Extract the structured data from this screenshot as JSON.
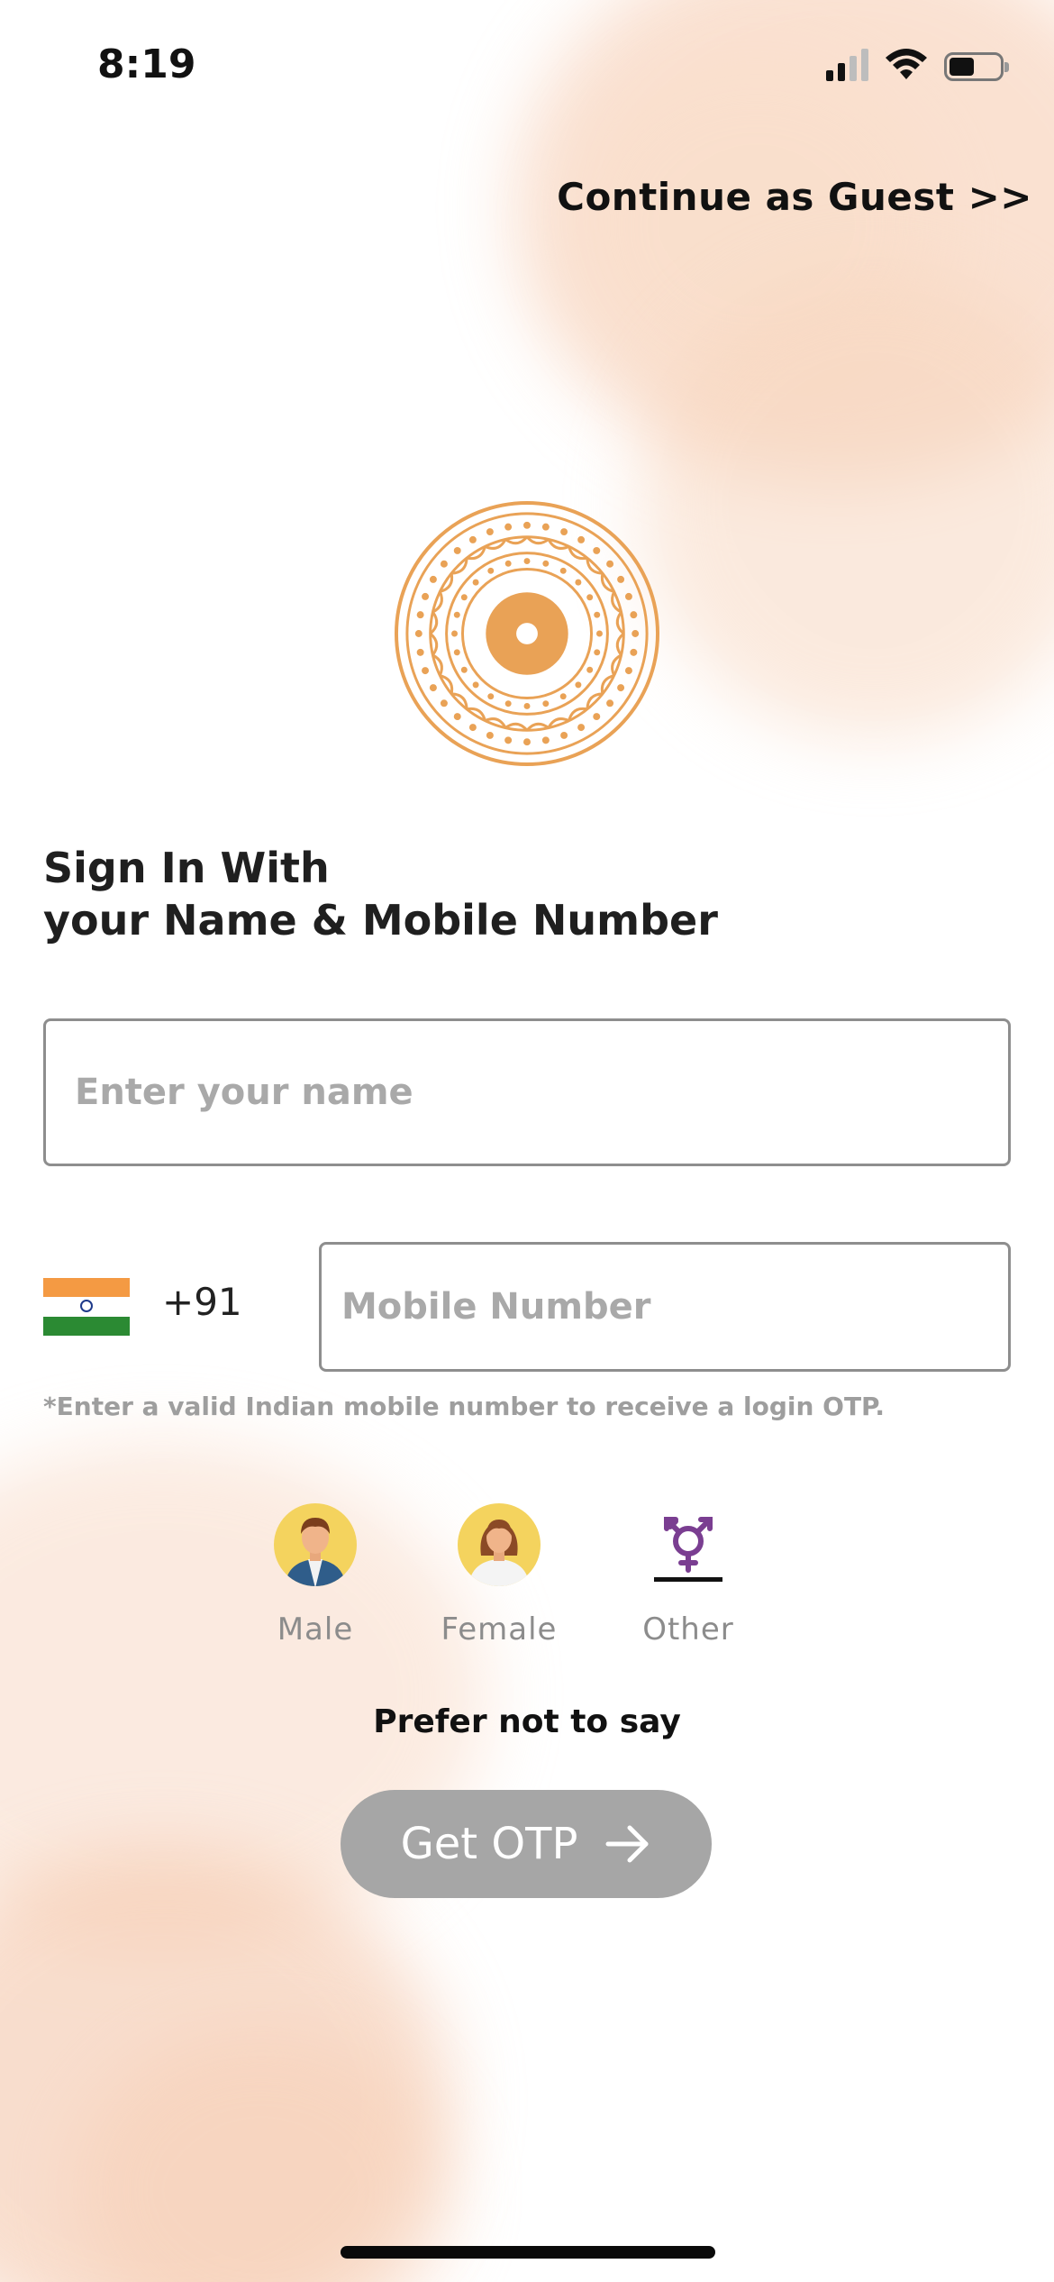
{
  "status_bar": {
    "time": "8:19",
    "icons": [
      "cellular-signal-icon",
      "wifi-icon",
      "battery-icon"
    ]
  },
  "guest_link": "Continue as Guest >>",
  "logo": {
    "icon": "mandala-logo",
    "color": "#e9a256"
  },
  "heading": {
    "line1": "Sign In With",
    "line2": "your Name & Mobile Number"
  },
  "name_field": {
    "placeholder": "Enter your name",
    "value": ""
  },
  "phone": {
    "flag_icon": "india-flag-icon",
    "country_code": "+91",
    "placeholder": "Mobile Number",
    "value": ""
  },
  "hint": "*Enter a valid Indian mobile number to receive a login OTP.",
  "gender": {
    "options": [
      {
        "label": "Male",
        "icon": "male-avatar-icon"
      },
      {
        "label": "Female",
        "icon": "female-avatar-icon"
      },
      {
        "label": "Other",
        "icon": "transgender-symbol-icon"
      }
    ],
    "prefer_not": "Prefer not to say"
  },
  "otp_button": {
    "label": "Get OTP",
    "icon": "arrow-right-icon",
    "color": "#a6a6a6"
  }
}
